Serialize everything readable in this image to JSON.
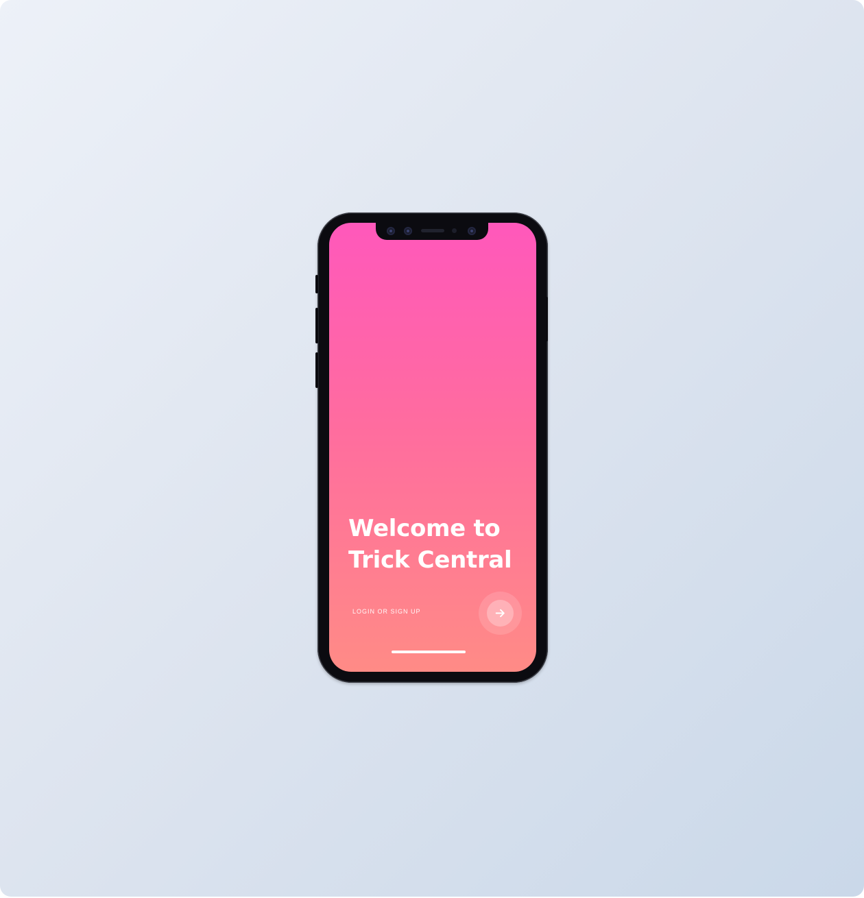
{
  "app": {
    "welcome_heading": "Welcome to Trick Central",
    "login_label": "LOGIN OR SIGN UP"
  },
  "icons": {
    "continue_button": "arrow-right-icon"
  },
  "colors": {
    "background_start": "#edf1f8",
    "background_end": "#cad8e9",
    "screen_gradient_top": "#ff58bb",
    "screen_gradient_bottom": "#ff8b86",
    "phone_body": "#0b0b10",
    "text": "#ffffff"
  }
}
